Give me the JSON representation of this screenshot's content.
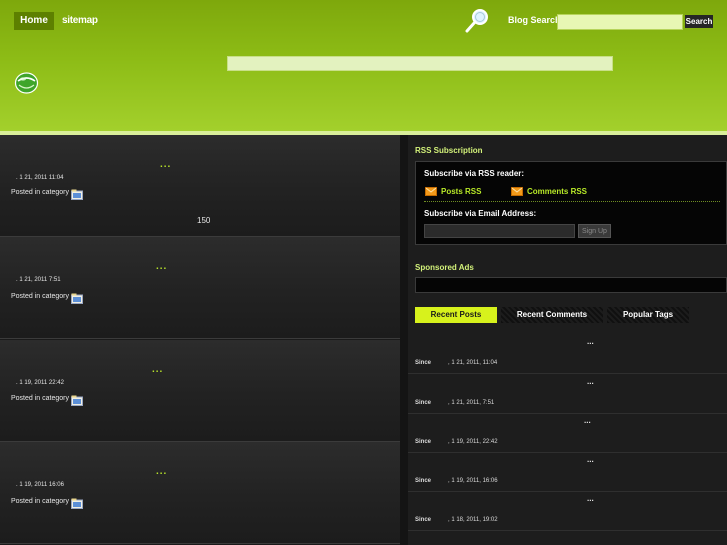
{
  "header": {
    "nav": [
      {
        "label": "Home"
      },
      {
        "label": "sitemap"
      }
    ],
    "search_label": "Blog Search",
    "search_value": "",
    "search_button": "Search"
  },
  "posts": [
    {
      "title": "...",
      "meta": ". 1   21, 2011 11:04",
      "category": "Posted in category",
      "extra": "150"
    },
    {
      "title": "...",
      "meta": ". 1   21, 2011 7:51",
      "category": "Posted in category",
      "extra": ""
    },
    {
      "title": "...",
      "meta": ". 1   19, 2011 22:42",
      "category": "Posted in category",
      "extra": ""
    },
    {
      "title": "...",
      "meta": ". 1   19, 2011 16:06",
      "category": "Posted in category",
      "extra": ""
    }
  ],
  "sidebar": {
    "rss_heading": "RSS Subscription",
    "rss_reader_label": "Subscribe via RSS reader:",
    "posts_rss": "Posts RSS",
    "comments_rss": "Comments RSS",
    "email_label": "Subscribe via Email Address:",
    "email_value": "",
    "signup": "Sign Up",
    "ads_heading": "Sponsored Ads",
    "tabs": [
      {
        "label": "Recent Posts",
        "active": true
      },
      {
        "label": "Recent Comments",
        "active": false
      },
      {
        "label": "Popular Tags",
        "active": false
      }
    ],
    "recent_posts": [
      {
        "title": "...",
        "since": "Since",
        "date": ", 1   21, 2011, 11:04"
      },
      {
        "title": "...",
        "since": "Since",
        "date": ", 1   21, 2011, 7:51"
      },
      {
        "title": "...",
        "since": "Since",
        "date": ", 1   19, 2011, 22:42"
      },
      {
        "title": "...",
        "since": "Since",
        "date": ", 1   19, 2011, 16:06"
      },
      {
        "title": "...",
        "since": "Since",
        "date": ", 1   18, 2011, 19:02"
      }
    ]
  },
  "colors": {
    "header_green": "#8dbc16",
    "accent_lime": "#b9ea28",
    "active_tab": "#d7f21c",
    "background_dark": "#1a1a1a"
  },
  "icons": [
    "magnifier-icon",
    "globe-icon",
    "category-folder-icon",
    "rss-feed-icon"
  ]
}
